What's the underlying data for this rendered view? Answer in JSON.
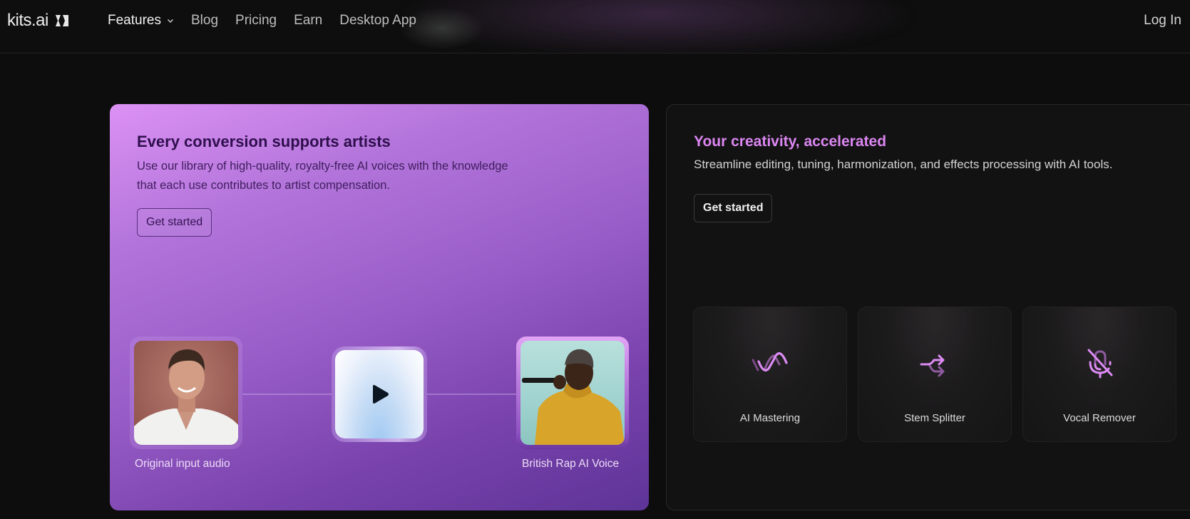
{
  "nav": {
    "logo_text": "kits.ai",
    "links": [
      {
        "label": "Features",
        "has_dropdown": true
      },
      {
        "label": "Blog"
      },
      {
        "label": "Pricing"
      },
      {
        "label": "Earn"
      },
      {
        "label": "Desktop App"
      }
    ],
    "login_label": "Log In"
  },
  "left_card": {
    "title": "Every conversion supports artists",
    "description": "Use our library of high-quality, royalty-free AI voices with the knowledge that each use contributes to artist compensation.",
    "cta_label": "Get started",
    "input_caption": "Original input audio",
    "output_caption": "British Rap AI Voice",
    "play_icon": "play-icon"
  },
  "right_card": {
    "title": "Your creativity, accelerated",
    "description": "Streamline editing, tuning, harmonization, and effects processing with AI tools.",
    "cta_label": "Get started",
    "tools": [
      {
        "label": "AI Mastering",
        "icon": "wave-icon"
      },
      {
        "label": "Stem Splitter",
        "icon": "split-arrows-icon"
      },
      {
        "label": "Vocal Remover",
        "icon": "mic-off-icon"
      }
    ]
  },
  "colors": {
    "accent": "#dc86f2",
    "background": "#0d0d0d",
    "card_purple_start": "#dc91f4",
    "card_purple_end": "#5e3498"
  }
}
